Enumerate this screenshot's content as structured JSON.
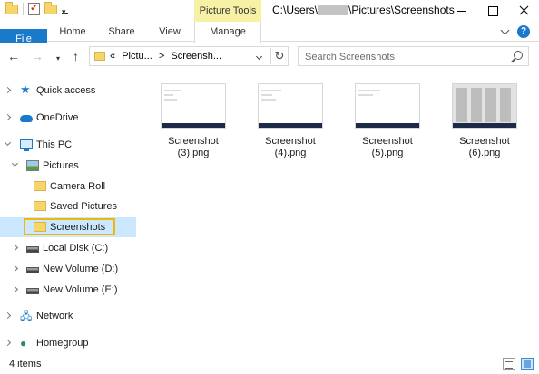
{
  "title_bar": {
    "contextual_tab_group": "Picture Tools",
    "path_prefix": "C:\\Users\\",
    "path_suffix": "\\Pictures\\Screenshots"
  },
  "ribbon": {
    "tabs": [
      {
        "label": "File",
        "active": true
      },
      {
        "label": "Home"
      },
      {
        "label": "Share"
      },
      {
        "label": "View"
      },
      {
        "label": "Manage"
      }
    ],
    "help_glyph": "?"
  },
  "address_bar": {
    "overflow": "«",
    "crumbs": [
      "Pictu...",
      "Screensh..."
    ],
    "separator": ">"
  },
  "search": {
    "placeholder": "Search Screenshots"
  },
  "nav_pane": {
    "items": [
      {
        "label": "Quick access",
        "icon": "star-icon"
      },
      {
        "label": "OneDrive",
        "icon": "cloud-icon"
      },
      {
        "label": "This PC",
        "icon": "computer-icon"
      },
      {
        "label": "Pictures",
        "icon": "pictures-icon"
      },
      {
        "label": "Camera Roll",
        "icon": "folder-icon"
      },
      {
        "label": "Saved Pictures",
        "icon": "folder-icon"
      },
      {
        "label": "Screenshots",
        "icon": "folder-icon",
        "selected": true
      },
      {
        "label": "Local Disk (C:)",
        "icon": "drive-icon"
      },
      {
        "label": "New Volume (D:)",
        "icon": "drive-icon"
      },
      {
        "label": "New Volume (E:)",
        "icon": "drive-icon"
      },
      {
        "label": "Network",
        "icon": "network-icon"
      },
      {
        "label": "Homegroup",
        "icon": "homegroup-icon"
      }
    ]
  },
  "files": [
    {
      "line1": "Screenshot",
      "line2": "(3).png"
    },
    {
      "line1": "Screenshot",
      "line2": "(4).png"
    },
    {
      "line1": "Screenshot",
      "line2": "(5).png"
    },
    {
      "line1": "Screenshot",
      "line2": "(6).png"
    }
  ],
  "status_bar": {
    "item_count": "4 items"
  },
  "colors": {
    "accent": "#1979ca",
    "selection": "#cce8ff",
    "highlight_border": "#f2b705",
    "contextual": "#f7f1a6"
  }
}
